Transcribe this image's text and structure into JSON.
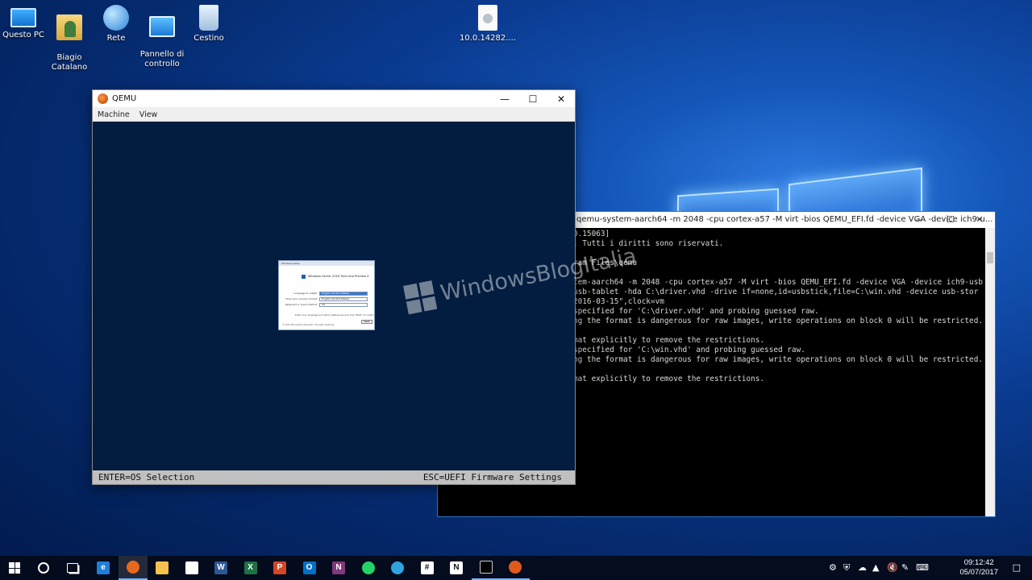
{
  "desktop": {
    "icons": [
      {
        "label": "Questo PC",
        "icon": "computer-icon"
      },
      {
        "label": "Biagio\nCatalano",
        "icon": "user-folder-icon"
      },
      {
        "label": "Rete",
        "icon": "network-icon"
      },
      {
        "label": "Pannello di\ncontrollo",
        "icon": "control-panel-icon"
      },
      {
        "label": "Cestino",
        "icon": "recycle-bin-icon"
      },
      {
        "label": "10.0.14282....",
        "icon": "disc-image-file-icon"
      }
    ],
    "watermark": "WindowsBlogItalia"
  },
  "qemu_window": {
    "title": "QEMU",
    "menu": [
      "Machine",
      "View"
    ],
    "status_left": "ENTER=OS Selection",
    "status_right": "ESC=UEFI Firmware Settings",
    "setup_dialog": {
      "title": "Windows Setup",
      "heading": "Windows Server 2016 Technical Preview 4",
      "fields": [
        {
          "label": "Language to install:",
          "value": "English (United States)",
          "selected": true
        },
        {
          "label": "Time and currency format:",
          "value": "English (United States)",
          "selected": false
        },
        {
          "label": "Keyboard or input method:",
          "value": "US",
          "selected": false
        }
      ],
      "hint": "Enter your language and other preferences and click \"Next\" to continue.",
      "copyright": "© 2015 Microsoft Corporation. All rights reserved.",
      "next_label": "Next"
    }
  },
  "console_window": {
    "title": "qemu-system-aarch64 -m 2048 -cpu cortex-a57 -M virt -bios QEMU_EFI.fd -device VGA -device ich9-u...",
    "lines": [
      "0.15063]",
      ". Tutti i diritti sono riservati.",
      "",
      "ram Files\\qemu",
      "",
      "tem-aarch64 -m 2048 -cpu cortex-a57 -M virt -bios QEMU_EFI.fd -device VGA -device ich9-usb",
      "usb-tablet -hda C:\\driver.vhd -drive if=none,id=usbstick,file=C:\\win.vhd -device usb-stor",
      "2016-03-15\",clock=vm",
      "specified for 'C:\\driver.vhd' and probing guessed raw.",
      "ng the format is dangerous for raw images, write operations on block 0 will be restricted.",
      "",
      "mat explicitly to remove the restrictions.",
      "specified for 'C:\\win.vhd' and probing guessed raw.",
      "ng the format is dangerous for raw images, write operations on block 0 will be restricted.",
      "",
      "mat explicitly to remove the restrictions."
    ]
  },
  "taskbar": {
    "apps": [
      {
        "name": "edge-icon",
        "glyph": "e",
        "color": "#1e7fd8"
      },
      {
        "name": "firefox-icon",
        "glyph": "",
        "color": "#e8691e"
      },
      {
        "name": "file-explorer-icon",
        "glyph": "",
        "color": "#f2c14e"
      },
      {
        "name": "store-icon",
        "glyph": "",
        "color": "#ffffff"
      },
      {
        "name": "word-icon",
        "glyph": "W",
        "color": "#2b5797"
      },
      {
        "name": "excel-icon",
        "glyph": "X",
        "color": "#1e7145"
      },
      {
        "name": "powerpoint-icon",
        "glyph": "P",
        "color": "#d24726"
      },
      {
        "name": "outlook-icon",
        "glyph": "O",
        "color": "#0072c6"
      },
      {
        "name": "onenote-icon",
        "glyph": "N",
        "color": "#80397b"
      },
      {
        "name": "whatsapp-icon",
        "glyph": "",
        "color": "#25d366"
      },
      {
        "name": "telegram-icon",
        "glyph": "",
        "color": "#2ca5e0"
      },
      {
        "name": "slack-icon",
        "glyph": "#",
        "color": "#ffffff"
      },
      {
        "name": "notion-icon",
        "glyph": "N",
        "color": "#ffffff"
      },
      {
        "name": "command-prompt-icon",
        "glyph": "",
        "color": "#000000"
      },
      {
        "name": "qemu-icon",
        "glyph": "",
        "color": "#e05a1c"
      }
    ],
    "time": "09:12:42",
    "date": "05/07/2017"
  }
}
